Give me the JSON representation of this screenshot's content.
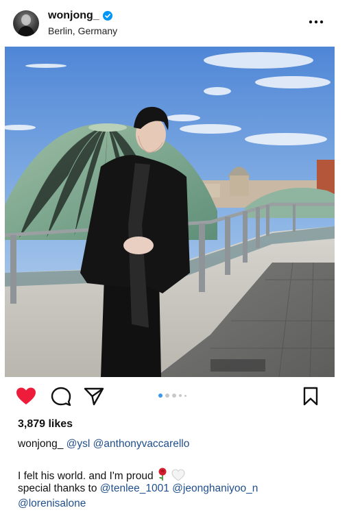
{
  "header": {
    "username": "wonjong_",
    "location": "Berlin, Germany",
    "verified": true
  },
  "post": {
    "likes": "3,879 likes",
    "caption_user": "wonjong_",
    "caption_mentions": [
      "@ysl",
      "@anthonyvaccarello"
    ],
    "body_line1": "I felt his world. and I'm proud",
    "body_line2_prefix": "special thanks to",
    "thanks_mentions": [
      "@tenlee_1001",
      "@jeonghaniyoo_n",
      "@lorenisalone"
    ],
    "carousel": {
      "count": 5,
      "active_index": 0
    }
  },
  "colors": {
    "like_red": "#ed1c3b",
    "mention_blue": "#1f4e8c",
    "dot_active": "#3897f0",
    "verified_blue": "#0095f6"
  },
  "icons": [
    "heart-icon",
    "comment-icon",
    "share-icon",
    "bookmark-icon",
    "more-icon",
    "verified-icon",
    "rose-emoji",
    "white-heart-emoji"
  ]
}
